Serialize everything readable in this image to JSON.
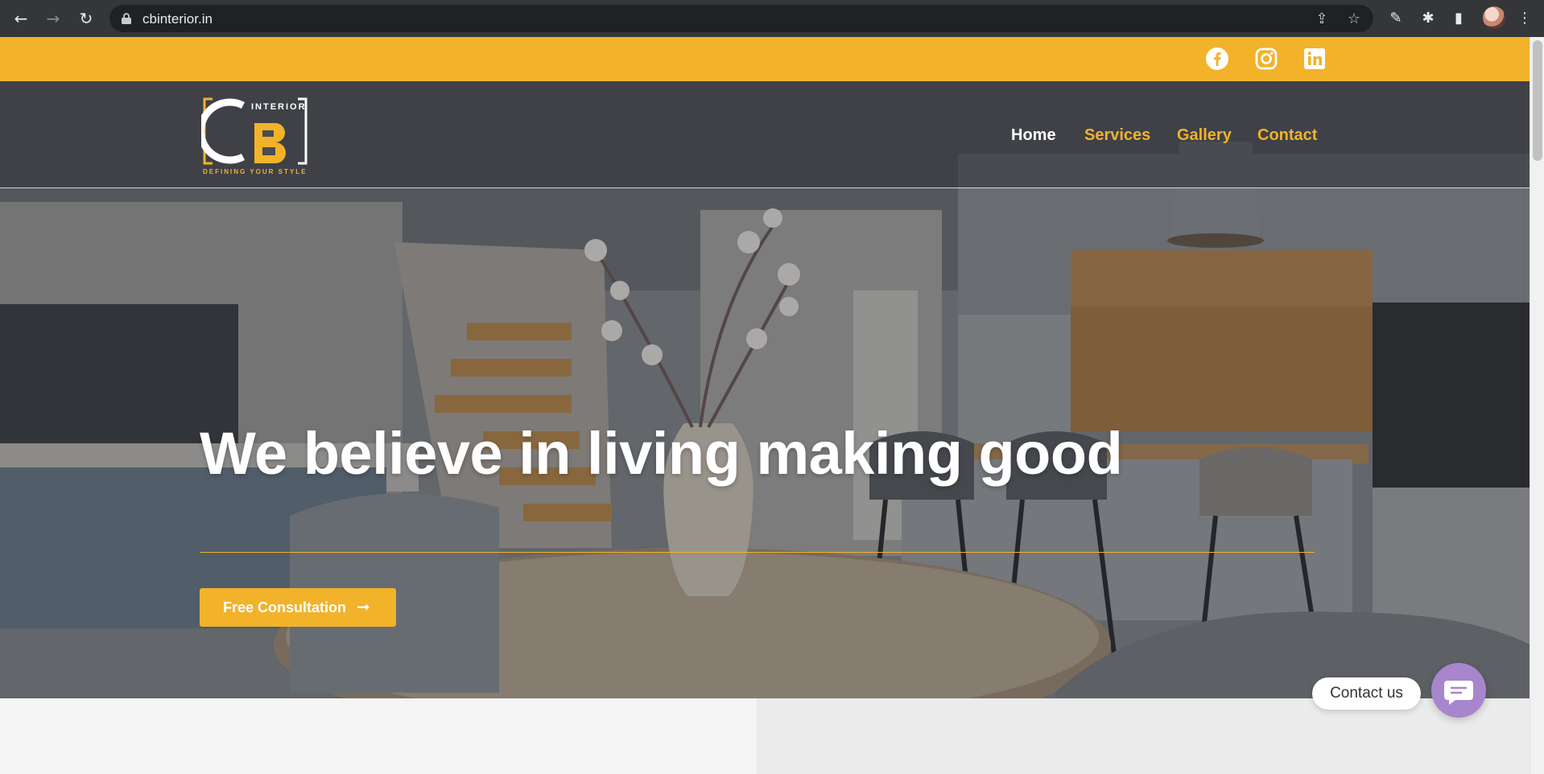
{
  "browser": {
    "url": "cbinterior.in",
    "back_icon": "back-arrow-icon",
    "forward_icon": "forward-arrow-icon",
    "reload_icon": "reload-icon"
  },
  "site": {
    "social": [
      "facebook-icon",
      "instagram-icon",
      "linkedin-icon"
    ],
    "logo": {
      "brand": "CB",
      "word": "INTERIOR",
      "tagline": "DEFINING YOUR STYLE"
    },
    "nav": [
      {
        "label": "Home",
        "active": true
      },
      {
        "label": "Services",
        "active": false
      },
      {
        "label": "Gallery",
        "active": false
      },
      {
        "label": "Contact",
        "active": false
      }
    ],
    "hero": {
      "headline": "We believe in living making good",
      "cta_label": "Free Consultation"
    },
    "contact_widget": {
      "label": "Contact us"
    }
  },
  "colors": {
    "accent": "#f2b22a",
    "chrome": "#35363a",
    "widget": "#a886cd"
  }
}
